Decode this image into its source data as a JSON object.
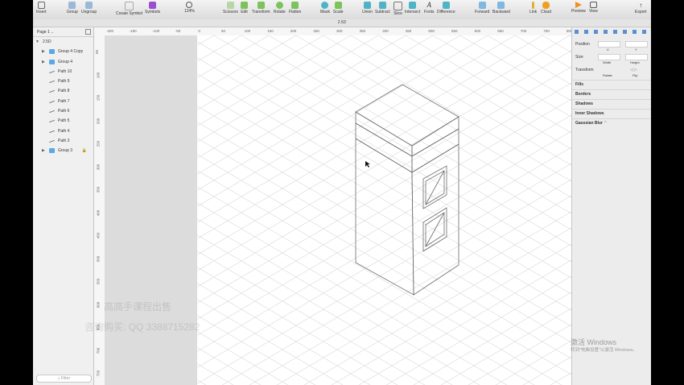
{
  "toolbar": {
    "items": [
      {
        "label": "Insert"
      },
      {
        "label": "Group"
      },
      {
        "label": "Ungroup"
      },
      {
        "label": "Create Symbol"
      },
      {
        "label": "Symbols"
      },
      {
        "label": "124%"
      },
      {
        "label": "Scissors"
      },
      {
        "label": "Edit"
      },
      {
        "label": "Transform"
      },
      {
        "label": "Rotate"
      },
      {
        "label": "Flatten"
      },
      {
        "label": "Mask"
      },
      {
        "label": "Scale"
      },
      {
        "label": "Union"
      },
      {
        "label": "Subtract"
      },
      {
        "label": "Slice"
      },
      {
        "label": "Intersect"
      },
      {
        "label": "Fonts"
      },
      {
        "label": "Difference"
      },
      {
        "label": "Forward"
      },
      {
        "label": "Backward"
      },
      {
        "label": "Link"
      },
      {
        "label": "Cloud"
      },
      {
        "label": "Preview"
      },
      {
        "label": "View"
      },
      {
        "label": "Export"
      }
    ]
  },
  "document_title": "2.5D",
  "layers": {
    "page": "Page 1",
    "rows": [
      {
        "label": "2.5D",
        "kind": "artboard",
        "expanded": true
      },
      {
        "label": "Group 4 Copy",
        "kind": "folder"
      },
      {
        "label": "Group 4",
        "kind": "folder"
      },
      {
        "label": "Path 10",
        "kind": "path"
      },
      {
        "label": "Path 9",
        "kind": "path"
      },
      {
        "label": "Path 8",
        "kind": "path"
      },
      {
        "label": "Path 7",
        "kind": "path"
      },
      {
        "label": "Path 6",
        "kind": "path"
      },
      {
        "label": "Path 5",
        "kind": "path"
      },
      {
        "label": "Path 4",
        "kind": "path"
      },
      {
        "label": "Path 3",
        "kind": "path"
      },
      {
        "label": "Group 3",
        "kind": "folder",
        "locked": true
      }
    ],
    "filter_placeholder": "Filter"
  },
  "hruler_ticks": [
    "-200",
    "-150",
    "-100",
    "-50",
    "0",
    "50",
    "100",
    "150",
    "200",
    "250",
    "300",
    "350",
    "400",
    "450",
    "500",
    "550",
    "600",
    "650",
    "700",
    "750",
    "800"
  ],
  "vruler_ticks": [
    "50",
    "100",
    "150",
    "200",
    "250",
    "300",
    "350",
    "400",
    "450",
    "500",
    "550",
    "600",
    "650",
    "700",
    "750"
  ],
  "inspector": {
    "position": "Position",
    "x": "X",
    "y": "Y",
    "size": "Size",
    "width": "Width",
    "height": "Height",
    "transform": "Transform",
    "rotate": "Rotate",
    "flip": "Flip",
    "sections": [
      "Fills",
      "Borders",
      "Shadows",
      "Inner Shadows",
      "Gaussian Blur"
    ]
  },
  "watermarks": {
    "line1": "高高手课程出售",
    "line2": "咨询购买: QQ 3388715282",
    "activate1": "激活 Windows",
    "activate2": "转到\"电脑设置\"以激活 Windows。"
  }
}
